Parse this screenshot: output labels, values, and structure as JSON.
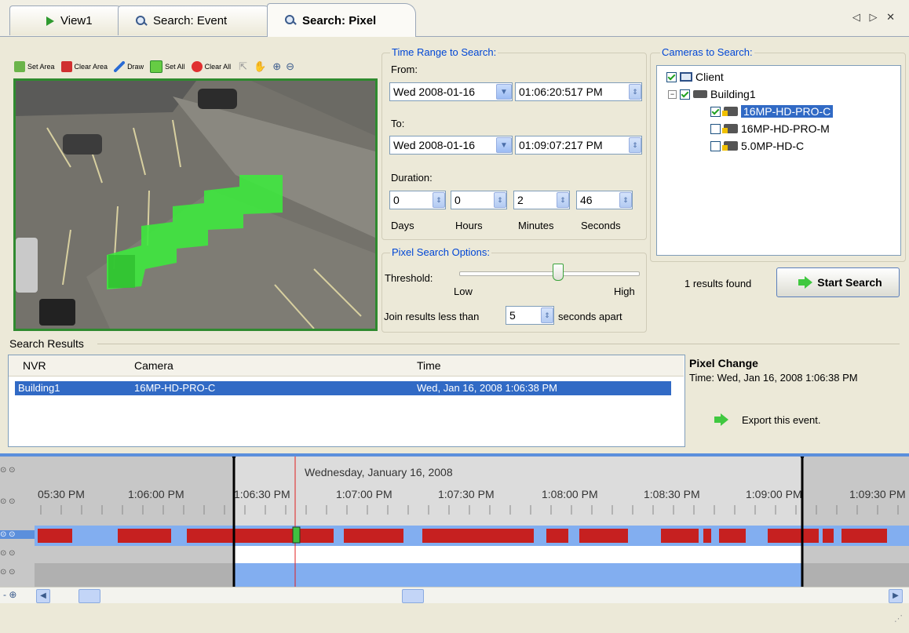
{
  "tabs": [
    {
      "label": "View1",
      "icon": "play-icon"
    },
    {
      "label": "Search: Event",
      "icon": "search-icon"
    },
    {
      "label": "Search: Pixel",
      "icon": "search-icon"
    }
  ],
  "window_controls": "◁ ▷ ✕",
  "toolbar": {
    "set_area": "Set Area",
    "clear_area": "Clear Area",
    "draw": "Draw",
    "set_all": "Set All",
    "clear_all": "Clear All"
  },
  "time_range": {
    "title": "Time Range to Search:",
    "from_label": "From:",
    "from_date": "Wed 2008-01-16",
    "from_time": "01:06:20:517  PM",
    "to_label": "To:",
    "to_date": "Wed 2008-01-16",
    "to_time": "01:09:07:217  PM",
    "duration_label": "Duration:",
    "days": "0",
    "hours": "0",
    "minutes": "2",
    "seconds": "46",
    "days_label": "Days",
    "hours_label": "Hours",
    "minutes_label": "Minutes",
    "seconds_label": "Seconds"
  },
  "pixel_options": {
    "title": "Pixel Search Options:",
    "threshold_label": "Threshold:",
    "low_label": "Low",
    "high_label": "High",
    "threshold_level": 0.55,
    "join_label": "Join results less than",
    "join_value": "5",
    "join_suffix": "seconds apart"
  },
  "cameras": {
    "title": "Cameras to Search:",
    "client": "Client",
    "site": "Building1",
    "items": [
      {
        "name": "16MP-HD-PRO-C",
        "checked": true
      },
      {
        "name": "16MP-HD-PRO-M",
        "checked": false
      },
      {
        "name": "5.0MP-HD-C",
        "checked": false
      }
    ]
  },
  "results_found": "1 results found",
  "start_search": "Start Search",
  "search_results": {
    "title": "Search Results",
    "columns": [
      "NVR",
      "Camera",
      "Time"
    ],
    "rows": [
      {
        "nvr": "Building1",
        "camera": "16MP-HD-PRO-C",
        "time": "Wed, Jan 16, 2008 1:06:38 PM"
      }
    ]
  },
  "pixel_change": {
    "title": "Pixel Change",
    "time": "Time: Wed, Jan 16, 2008 1:06:38 PM",
    "export": "Export this event."
  },
  "timeline": {
    "date": "Wednesday, January 16, 2008",
    "ticks": [
      "05:30 PM",
      "1:06:00 PM",
      "1:06:30 PM",
      "1:07:00 PM",
      "1:07:30 PM",
      "1:08:00 PM",
      "1:08:30 PM",
      "1:09:00 PM",
      "1:09:30 PM"
    ]
  },
  "colors": {
    "accent": "#0046d5",
    "selection": "#316ac5",
    "motion": "#c62020",
    "idle": "#82aef0"
  }
}
